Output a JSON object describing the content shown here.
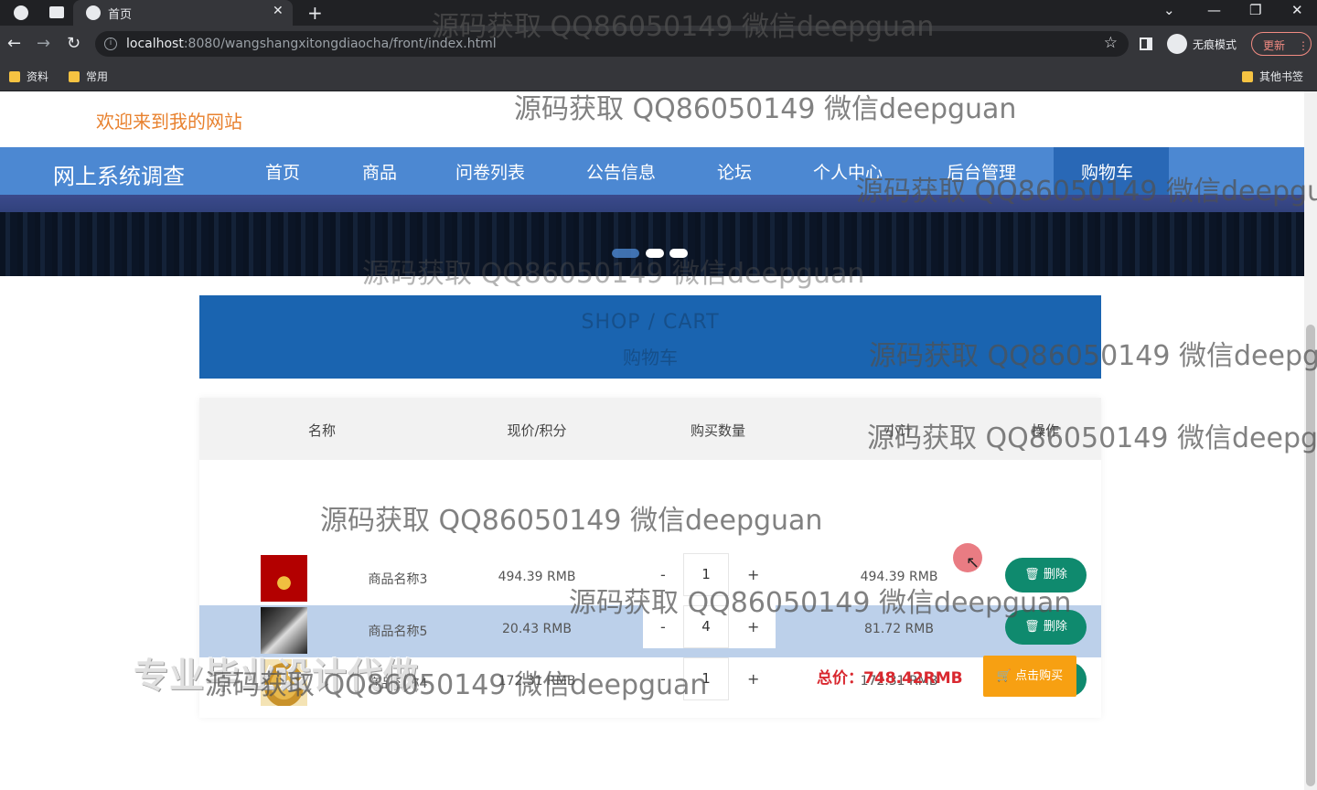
{
  "browser": {
    "tab_title": "首页",
    "url_host": "localhost",
    "url_rest": ":8080/wangshangxitongdiaocha/front/index.html",
    "incognito_label": "无痕模式",
    "update_label": "更新",
    "bookmarks": [
      "资料",
      "常用"
    ],
    "other_bookmarks": "其他书签"
  },
  "site": {
    "welcome": "欢迎来到我的网站",
    "brand": "网上系统调查",
    "nav": [
      "首页",
      "商品",
      "问卷列表",
      "公告信息",
      "论坛",
      "个人中心",
      "后台管理",
      "购物车"
    ]
  },
  "cart": {
    "title_en": "SHOP / CART",
    "title_zh": "购物车",
    "headers": {
      "name": "名称",
      "price": "现价/积分",
      "qty": "购买数量",
      "subtotal": "小计",
      "actions": "操作"
    },
    "rows": [
      {
        "name": "商品名称3",
        "price": "494.39 RMB",
        "qty": "1",
        "subtotal": "494.39 RMB",
        "delete": "删除"
      },
      {
        "name": "商品名称5",
        "price": "20.43 RMB",
        "qty": "4",
        "subtotal": "81.72 RMB",
        "delete": "删除"
      },
      {
        "name": "商品名称4",
        "price": "172.31 RMB",
        "qty": "1",
        "subtotal": "172.31 RMB",
        "delete": "删除"
      }
    ],
    "total": "总价：748.42RMB",
    "buy_label": "点击购买",
    "minus": "-",
    "plus": "+"
  },
  "overlay": {
    "promo": "专业毕业设计代做",
    "watermark": "源码获取 QQ86050149 微信deepguan"
  }
}
